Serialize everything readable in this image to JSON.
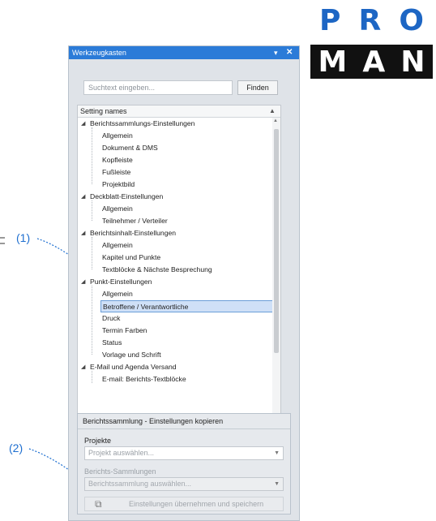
{
  "logo": {
    "row1": [
      "P",
      "R",
      "O"
    ],
    "row2": [
      "M",
      "A",
      "N"
    ],
    "brand_blue": "#1d66c4"
  },
  "annotations": {
    "label1": "(1)",
    "label2": "(2)",
    "color": "#1e6fd0"
  },
  "panel": {
    "title": "Werkzeugkasten",
    "pin_icon": "pin-icon",
    "close_icon": "close-icon",
    "search_placeholder": "Suchtext eingeben...",
    "find_label": "Finden",
    "tree_header": "Setting names",
    "tree": [
      {
        "label": "Berichtssammlungs-Einstellungen",
        "children": [
          "Allgemein",
          "Dokument & DMS",
          "Kopfleiste",
          "Fußleiste",
          "Projektbild"
        ]
      },
      {
        "label": "Deckblatt-Einstellungen",
        "children": [
          "Allgemein",
          "Teilnehmer / Verteiler"
        ]
      },
      {
        "label": "Berichtsinhalt-Einstellungen",
        "children": [
          "Allgemein",
          "Kapitel und Punkte",
          "Textblöcke & Nächste Besprechung"
        ]
      },
      {
        "label": "Punkt-Einstellungen",
        "children": [
          "Allgemein",
          "Betroffene / Verantwortliche",
          "Druck",
          "Termin Farben",
          "Status",
          "Vorlage und Schrift"
        ]
      },
      {
        "label": "E-Mail und Agenda Versand",
        "children": [
          "E-mail: Berichts-Textblöcke"
        ]
      }
    ],
    "selected_item": "Betroffene / Verantwortliche"
  },
  "copy_group": {
    "title": "Berichtssammlung - Einstellungen kopieren",
    "projects_label": "Projekte",
    "projects_placeholder": "Projekt auswählen...",
    "collections_label": "Berichts-Sammlungen",
    "collections_placeholder": "Berichtssammlung auswählen...",
    "apply_label": "Einstellungen übernehmen und speichern"
  }
}
